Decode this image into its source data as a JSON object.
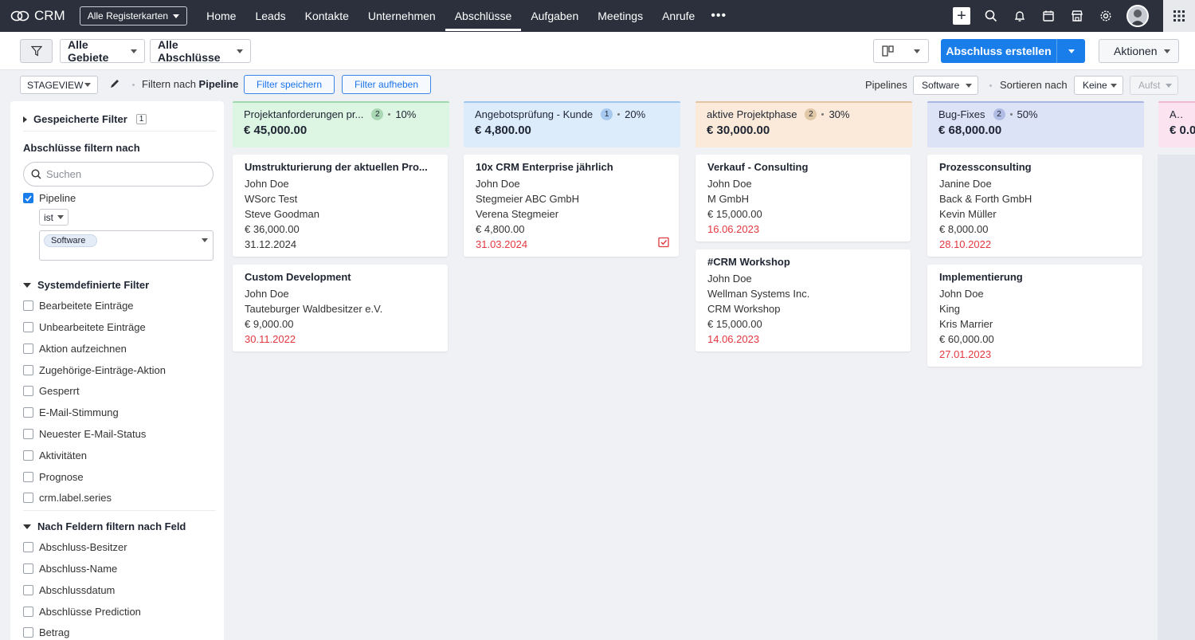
{
  "app": {
    "name": "CRM"
  },
  "nav": {
    "tab_select": "Alle Registerkarten",
    "items": [
      "Home",
      "Leads",
      "Kontakte",
      "Unternehmen",
      "Abschlüsse",
      "Aufgaben",
      "Meetings",
      "Anrufe"
    ],
    "more": "•••",
    "active": "Abschlüsse"
  },
  "toolbar": {
    "territory": "Alle Gebiete",
    "view": "Alle Abschlüsse",
    "create": "Abschluss erstellen",
    "actions": "Aktionen"
  },
  "filterbar": {
    "stageview": "STAGEVIEW",
    "filter_prefix": "Filtern nach",
    "filter_field": "Pipeline",
    "save_filter": "Filter speichern",
    "clear_filter": "Filter aufheben",
    "pipelines_label": "Pipelines",
    "pipeline_value": "Software",
    "sort_label": "Sortieren nach",
    "sort_value": "Keine",
    "order_value": "Aufst"
  },
  "sidebar": {
    "saved_filters": "Gespeicherte Filter",
    "saved_count": "1",
    "filter_by": "Abschlüsse filtern nach",
    "search_placeholder": "Suchen",
    "pipeline_label": "Pipeline",
    "operator": "ist",
    "chip": "Software",
    "system_title": "Systemdefinierte Filter",
    "system_filters": [
      "Bearbeitete Einträge",
      "Unbearbeitete Einträge",
      "Aktion aufzeichnen",
      "Zugehörige-Einträge-Aktion",
      "Gesperrt",
      "E-Mail-Stimmung",
      "Neuester E-Mail-Status",
      "Aktivitäten",
      "Prognose",
      "crm.label.series"
    ],
    "field_title": "Nach Feldern filtern nach Feld",
    "field_filters": [
      "Abschluss-Besitzer",
      "Abschluss-Name",
      "Abschlussdatum",
      "Abschlüsse Prediction",
      "Betrag"
    ]
  },
  "columns": [
    {
      "name": "Projektanforderungen pr...",
      "count": "2",
      "pct": "10%",
      "amount": "€ 45,000.00",
      "color": "#ddf5e3",
      "border": "#9fd8ad",
      "badge": "#a9d7b4",
      "cards": [
        {
          "title": "Umstrukturierung der aktuellen Pro...",
          "owner": "John Doe",
          "account": "WSorc Test",
          "contact": "Steve Goodman",
          "amount": "€ 36,000.00",
          "date": "31.12.2024"
        },
        {
          "title": "Custom Development",
          "owner": "John Doe",
          "account": "Tauteburger Waldbesitzer e.V.",
          "amount": "€ 9,000.00",
          "date": "30.11.2022"
        }
      ]
    },
    {
      "name": "Angebotsprüfung - Kunde",
      "count": "1",
      "pct": "20%",
      "amount": "€ 4,800.00",
      "color": "#dcecfb",
      "border": "#9ec5ee",
      "badge": "#a8c9ef",
      "cards": [
        {
          "title": "10x CRM Enterprise jährlich",
          "owner": "John Doe",
          "account": "Stegmeier ABC GmbH",
          "contact": "Verena Stegmeier",
          "amount": "€ 4,800.00",
          "date": "31.03.2024"
        }
      ]
    },
    {
      "name": "aktive Projektphase",
      "count": "2",
      "pct": "30%",
      "amount": "€ 30,000.00",
      "color": "#fbead9",
      "border": "#e4c5a2",
      "badge": "#e0c7a6",
      "cards": [
        {
          "title": "Verkauf - Consulting",
          "owner": "John Doe",
          "account": "M GmbH",
          "amount": "€ 15,000.00",
          "date": "16.06.2023"
        },
        {
          "title": "#CRM Workshop",
          "owner": "John Doe",
          "account": "Wellman Systems Inc.",
          "contact": "CRM Workshop",
          "amount": "€ 15,000.00",
          "date": "14.06.2023"
        }
      ]
    },
    {
      "name": "Bug-Fixes",
      "count": "2",
      "pct": "50%",
      "amount": "€ 68,000.00",
      "color": "#dde3f6",
      "border": "#aab6e2",
      "badge": "#b1bce4",
      "cards": [
        {
          "title": "Prozessconsulting",
          "owner": "Janine Doe",
          "account": "Back & Forth GmbH",
          "contact": "Kevin Müller",
          "amount": "€ 8,000.00",
          "date": "28.10.2022"
        },
        {
          "title": "Implementierung",
          "owner": "John Doe",
          "account": "King",
          "contact": "Kris Marrier",
          "amount": "€ 60,000.00",
          "date": "27.01.2023"
        }
      ]
    },
    {
      "name": "Abna",
      "amount": "€ 0.0",
      "color": "#fbe3ef",
      "border": "#eeb7d2"
    }
  ]
}
